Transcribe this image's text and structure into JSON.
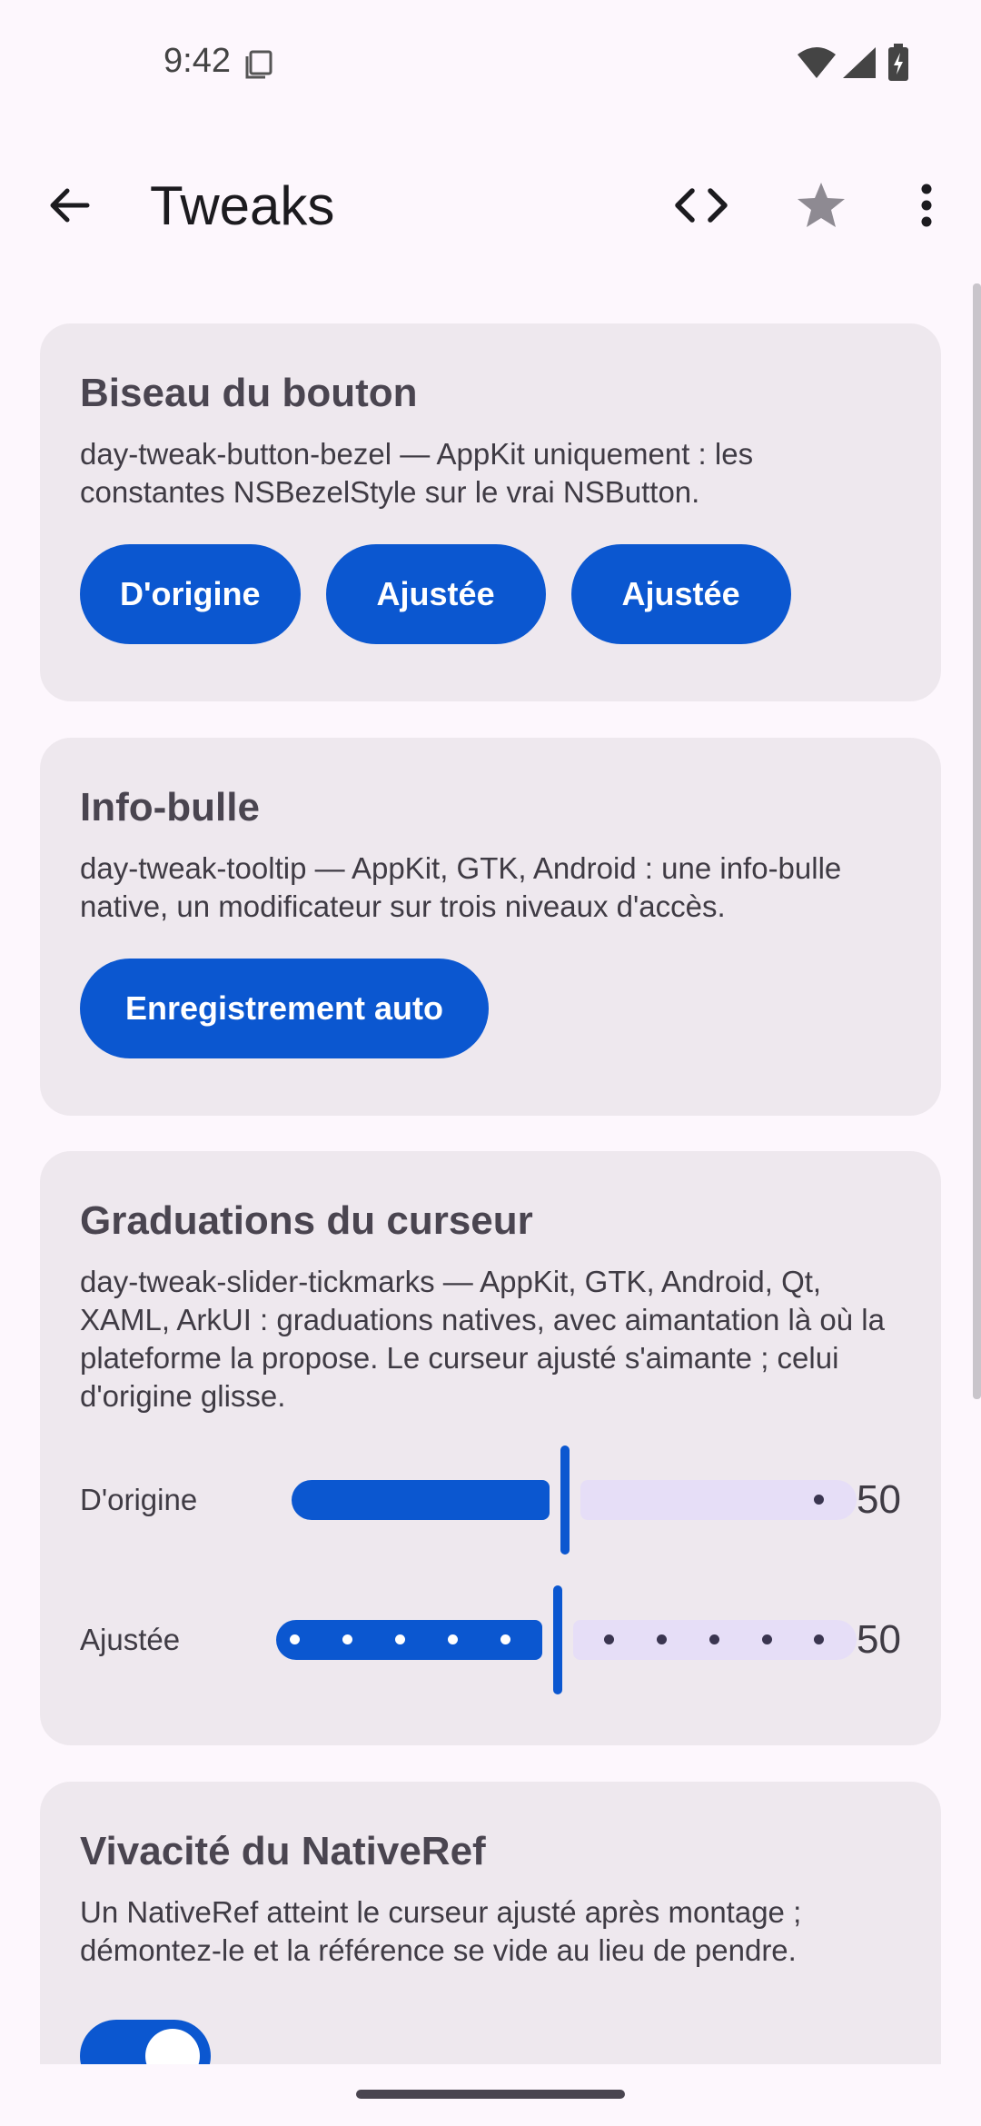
{
  "status_bar": {
    "time": "9:42",
    "icons": [
      "screen-icon",
      "wifi-icon",
      "signal-icon",
      "battery-charging-icon"
    ]
  },
  "app_bar": {
    "title": "Tweaks",
    "icons": [
      "back-arrow-icon",
      "code-icon",
      "star-icon",
      "more-vert-icon"
    ]
  },
  "cards": {
    "bezel": {
      "title": "Biseau du bouton",
      "description": "day-tweak-button-bezel — AppKit uniquement : les constantes NSBezelStyle sur le vrai NSButton.",
      "buttons": [
        "D'origine",
        "Ajustée",
        "Ajustée"
      ]
    },
    "tooltip": {
      "title": "Info-bulle",
      "description": "day-tweak-tooltip — AppKit, GTK, Android : une info-bulle native, un modificateur sur trois niveaux d'accès.",
      "button": "Enregistrement auto"
    },
    "slider": {
      "title": "Graduations du curseur",
      "description": "day-tweak-slider-tickmarks — AppKit, GTK, Android, Qt, XAML, ArkUI : graduations natives, avec aimantation là où la plateforme la propose. Le curseur ajusté s'aimante ; celui d'origine glisse.",
      "rows": [
        {
          "label": "D'origine",
          "value": "50",
          "fraction": 0.5
        },
        {
          "label": "Ajustée",
          "value": "50",
          "fraction": 0.5
        }
      ]
    },
    "nativeref": {
      "title": "Vivacité du NativeRef",
      "description": "Un NativeRef atteint le curseur ajusté après montage ; démontez-le et la référence se vide au lieu de pendre.",
      "toggle_on": true
    }
  },
  "colors": {
    "accent": "#0B57D0",
    "card": "#EEE8EE",
    "background": "#FDF7FD",
    "inactive_track": "#E6DEF7"
  }
}
